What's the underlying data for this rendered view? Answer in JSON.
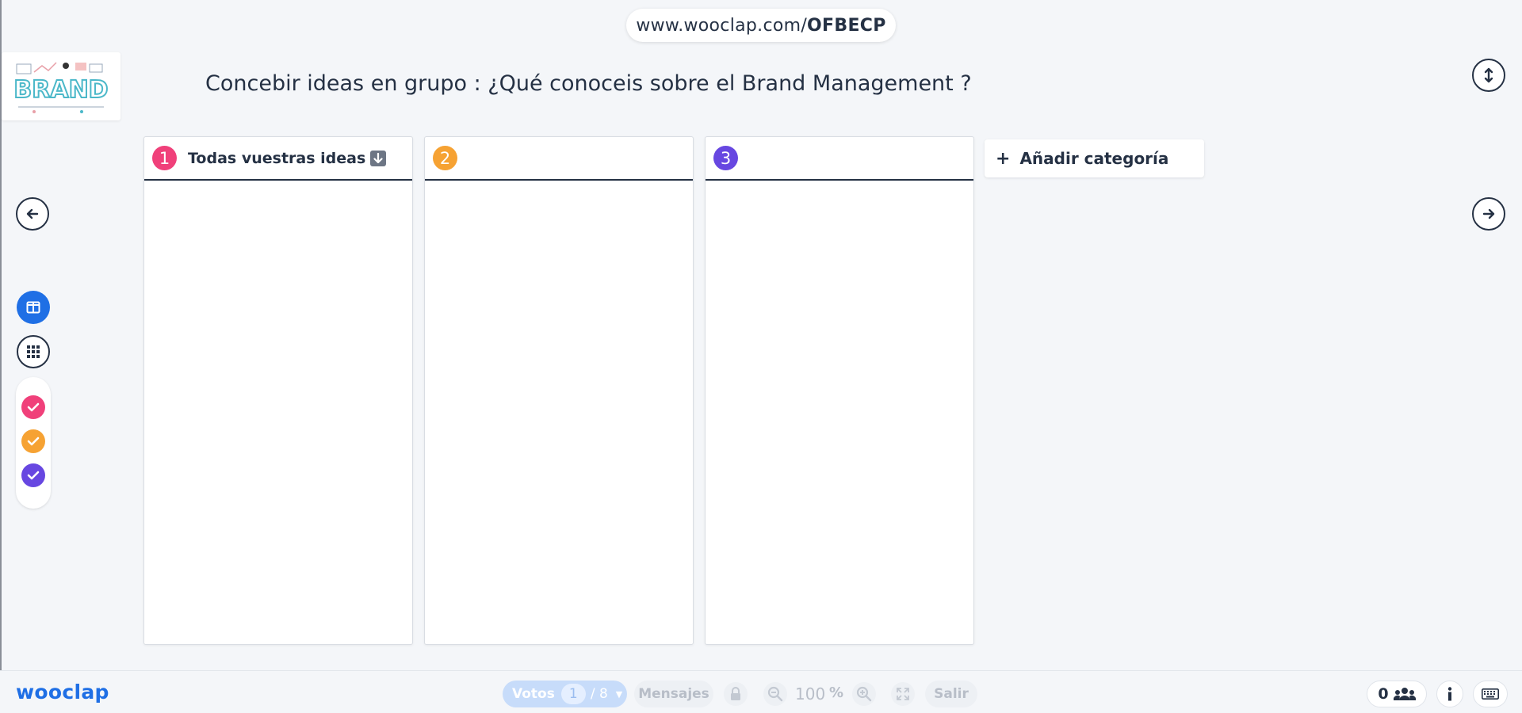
{
  "header": {
    "url_prefix": "www.wooclap.com/",
    "event_code": "OFBECP"
  },
  "logo": {
    "text": "BRAND"
  },
  "question": {
    "title": "Concebir ideas en grupo : ¿Qué conoceis sobre el Brand Management ?"
  },
  "columns": [
    {
      "number": "1",
      "title": "Todas vuestras ideas",
      "color": "#f0407a"
    },
    {
      "number": "2",
      "title": "",
      "color": "#f6a233"
    },
    {
      "number": "3",
      "title": "",
      "color": "#6747e1"
    }
  ],
  "add_category": {
    "label": "Añadir categoría"
  },
  "filters": [
    {
      "icon": "check-icon",
      "color": "#f0407a"
    },
    {
      "icon": "check-icon",
      "color": "#f6a233"
    },
    {
      "icon": "check-icon",
      "color": "#6747e1"
    }
  ],
  "footer": {
    "brand": "wooclap",
    "votes_label": "Votos",
    "votes_current": "1",
    "votes_total": "/ 8",
    "messages_label": "Mensajes",
    "zoom_value": "100",
    "zoom_unit": "%",
    "exit_label": "Salir",
    "participants_count": "0"
  },
  "colors": {
    "accent": "#1f6fe5",
    "text": "#253144",
    "background": "#f4f6f9"
  }
}
